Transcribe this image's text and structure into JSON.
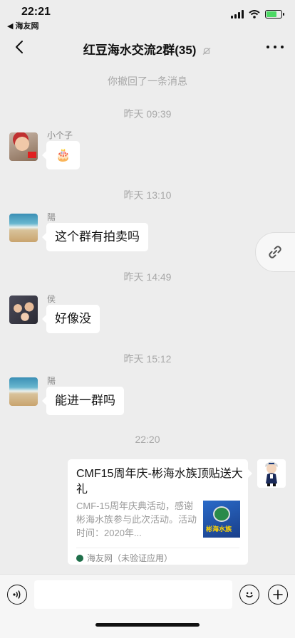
{
  "status_bar": {
    "time": "22:21",
    "back_app": "◀ 海友网",
    "battery_level": 0.7,
    "battery_color": "#4cd964"
  },
  "nav": {
    "title": "红豆海水交流2群(35)"
  },
  "chat": {
    "recall_notice": "你撤回了一条消息",
    "messages": [
      {
        "timestamp": "昨天 09:39",
        "sender": "小个子",
        "text": "🎂"
      },
      {
        "timestamp": "昨天 13:10",
        "sender": "陽",
        "text": "这个群有拍卖吗"
      },
      {
        "timestamp": "昨天 14:49",
        "sender": "侯",
        "text": "好像没"
      },
      {
        "timestamp": "昨天 15:12",
        "sender": "陽",
        "text": "能进一群吗"
      }
    ],
    "share_timestamp": "22:20",
    "share_card": {
      "title": "CMF15周年庆-彬海水族顶贴送大礼",
      "description": "CMF-15周年庆典活动，感谢彬海水族参与此次活动。活动时间：2020年...",
      "thumb_text": "彬海水族",
      "source": "海友网（未验证应用）"
    }
  },
  "input_bar": {
    "placeholder": ""
  },
  "colors": {
    "background": "#ededed",
    "bubble": "#ffffff",
    "system_text": "#a8a8a8"
  }
}
